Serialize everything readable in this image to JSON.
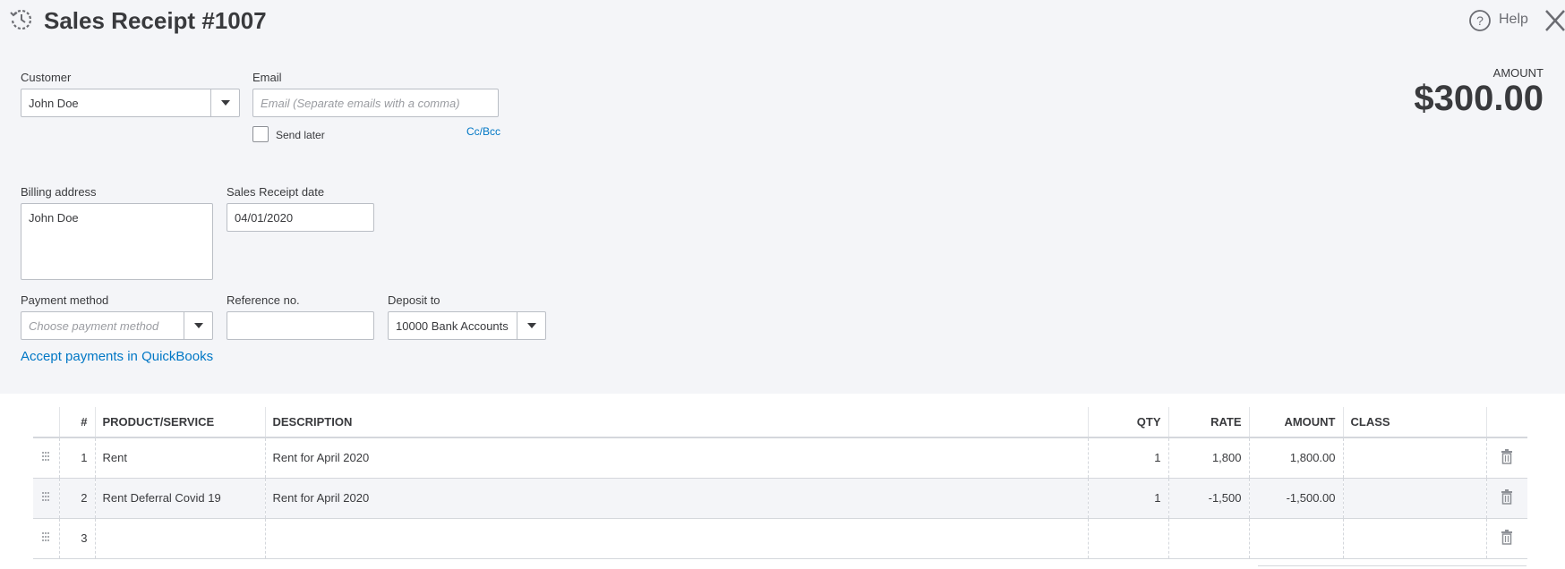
{
  "header": {
    "title": "Sales Receipt #1007",
    "help_label": "Help"
  },
  "customer": {
    "label": "Customer",
    "value": "John Doe"
  },
  "email": {
    "label": "Email",
    "placeholder": "Email (Separate emails with a comma)",
    "send_later_label": "Send later",
    "send_later_checked": false,
    "ccbcc_label": "Cc/Bcc"
  },
  "amount": {
    "label": "AMOUNT",
    "value": "$300.00"
  },
  "billing": {
    "label": "Billing address",
    "value": "John Doe"
  },
  "receipt_date": {
    "label": "Sales Receipt date",
    "value": "04/01/2020"
  },
  "payment_method": {
    "label": "Payment method",
    "placeholder": "Choose payment method"
  },
  "reference": {
    "label": "Reference no.",
    "value": ""
  },
  "deposit": {
    "label": "Deposit to",
    "value": "10000 Bank Accounts"
  },
  "accept_payments_link": "Accept payments in QuickBooks",
  "table": {
    "headers": {
      "num": "#",
      "product": "PRODUCT/SERVICE",
      "description": "DESCRIPTION",
      "qty": "QTY",
      "rate": "RATE",
      "amount": "AMOUNT",
      "class": "CLASS"
    },
    "rows": [
      {
        "num": "1",
        "product": "Rent",
        "description": "Rent for April 2020",
        "qty": "1",
        "rate": "1,800",
        "amount": "1,800.00",
        "class": ""
      },
      {
        "num": "2",
        "product": "Rent Deferral Covid 19",
        "description": "Rent for April 2020",
        "qty": "1",
        "rate": "-1,500",
        "amount": "-1,500.00",
        "class": ""
      },
      {
        "num": "3",
        "product": "",
        "description": "",
        "qty": "",
        "rate": "",
        "amount": "",
        "class": ""
      }
    ]
  },
  "colors": {
    "link": "#0077c5",
    "panel_bg": "#f4f5f8",
    "text": "#393a3d"
  },
  "icons": {
    "history": "history-clock-icon",
    "help": "help-circle-icon",
    "close": "close-icon",
    "drag": "drag-handle-icon",
    "delete": "trash-icon"
  }
}
